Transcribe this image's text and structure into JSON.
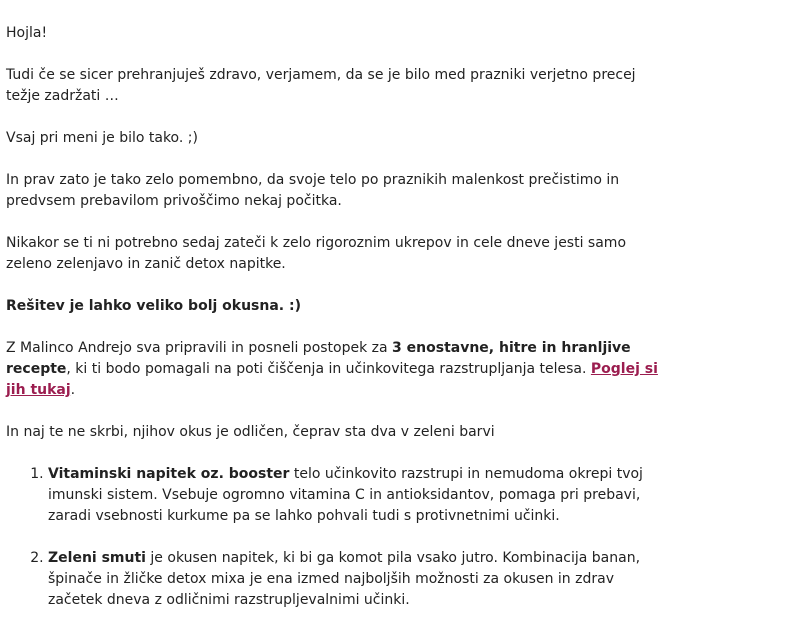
{
  "greeting": "Hojla!",
  "paragraphs": {
    "p1": "Tudi če se sicer prehranjuješ zdravo, verjamem, da se je bilo med prazniki verjetno precej težje zadržati …",
    "p2": "Vsaj pri meni je bilo tako. ;)",
    "p3": "In prav zato je tako zelo pomembno, da svoje telo po praznikih malenkost prečistimo in predvsem prebavilom privoščimo nekaj počitka.",
    "p4": "Nikakor se ti ni potrebno sedaj zateči k zelo rigoroznim ukrepov in cele dneve jesti samo zeleno zelenjavo in zanič detox napitke.",
    "p5_bold": "Rešitev je lahko veliko bolj okusna. :)",
    "p6_intro": "Z Malinco Andrejo sva pripravili in posneli postopek za ",
    "p6_bold": "3 enostavne, hitre in hranljive recepte",
    "p6_middle": ", ki ti bodo pomagali na poti čiščenja in učinkovitega razstrupljanja telesa. ",
    "p6_link": "Poglej si jih tukaj",
    "p6_end": ".",
    "p7": "In naj te ne skrbi, njihov okus je odličen, čeprav sta dva v zeleni barvi"
  },
  "list": [
    {
      "title": "Vitaminski napitek oz. booster",
      "text": " telo učinkovito razstrupi in nemudoma okrepi tvoj imunski sistem. Vsebuje ogromno vitamina C in antioksidantov, pomaga pri prebavi, zaradi vsebnosti kurkume pa se lahko pohvali tudi s protivnetnimi učinki."
    },
    {
      "title": "Zeleni smuti",
      "text": " je okusen napitek, ki bi ga komot pila vsako jutro. Kombinacija banan, špinače in žličke detox mixa je ena izmed najboljših možnosti za okusen in zdrav začetek dneva z odličnimi razstrupljevalnimi učinki."
    }
  ],
  "colors": {
    "text": "#222222",
    "link": "#9b1d4f",
    "background": "#ffffff"
  }
}
